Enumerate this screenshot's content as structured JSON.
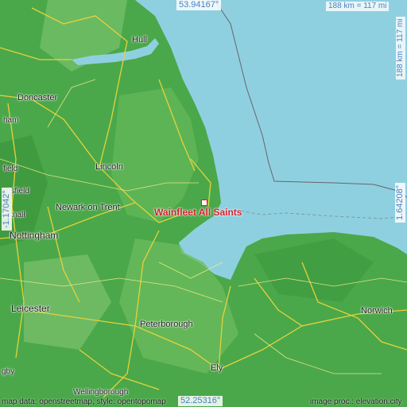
{
  "map": {
    "colors": {
      "sea": "#8fd0e0",
      "land": "#4aa84a",
      "land_light": "#7cc46a",
      "roads": "#e8d43a",
      "boundary": "#666666",
      "marker": "#d6202a"
    },
    "target": {
      "name": "Wainfleet All Saints"
    },
    "coordinates": {
      "top": "53.94167°",
      "bottom": "52.25316°",
      "left": "-1.17042°",
      "right": "1.64208°"
    },
    "scale": {
      "top": "188 km = 117 mi",
      "right": "188 km = 117 mi"
    },
    "credits": {
      "left": "map data: openstreetmap, style: opentopomap",
      "right": "image proc.: elevation.city"
    },
    "places": [
      {
        "id": "hull",
        "name": "Hull"
      },
      {
        "id": "doncaster",
        "name": "Doncaster"
      },
      {
        "id": "lincoln",
        "name": "Lincoln"
      },
      {
        "id": "newark",
        "name": "Newark on Trent"
      },
      {
        "id": "nottingham",
        "name": "Nottingham"
      },
      {
        "id": "leicester",
        "name": "Leicester"
      },
      {
        "id": "peterborough",
        "name": "Peterborough"
      },
      {
        "id": "norwich",
        "name": "Norwich"
      },
      {
        "id": "ely",
        "name": "Ely"
      },
      {
        "id": "wellingborough",
        "name": "Wellingborough"
      },
      {
        "id": "mansfield",
        "name": "nsfield"
      },
      {
        "id": "sheffield",
        "name": "field"
      },
      {
        "id": "worksop",
        "name": "ham"
      },
      {
        "id": "hucknall",
        "name": "cknall"
      },
      {
        "id": "rugby",
        "name": "gby"
      }
    ]
  }
}
